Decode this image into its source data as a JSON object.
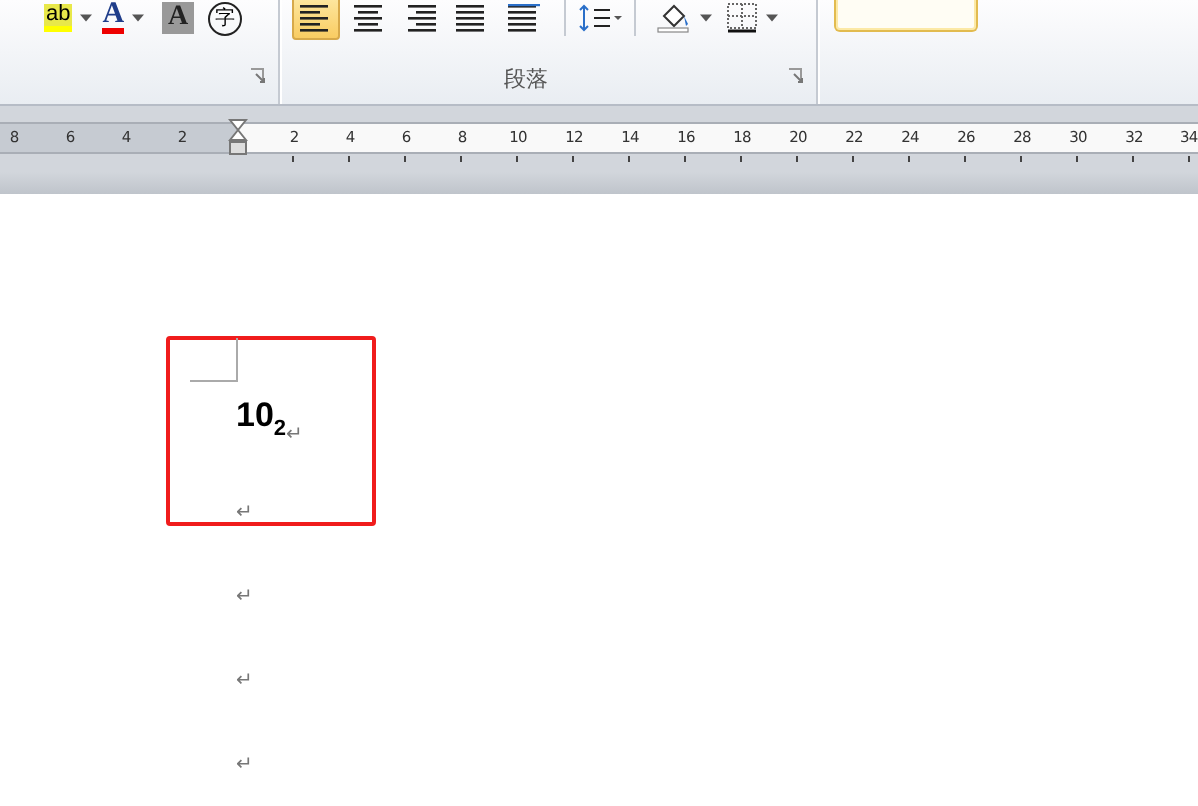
{
  "ribbon": {
    "font_buttons": [
      {
        "kind": "highlight",
        "glyph": "ab"
      },
      {
        "kind": "font_color",
        "glyph": "A"
      },
      {
        "kind": "shading",
        "glyph": "A"
      },
      {
        "kind": "enclosed",
        "glyph": "字"
      }
    ],
    "alignment": [
      {
        "kind": "left",
        "selected": true
      },
      {
        "kind": "center",
        "selected": false
      },
      {
        "kind": "right",
        "selected": false
      },
      {
        "kind": "justify",
        "selected": false
      },
      {
        "kind": "distributed",
        "selected": false
      }
    ],
    "paragraph_label": "段落"
  },
  "ruler": {
    "left_labels": [
      "8",
      "6",
      "4",
      "2"
    ],
    "labels": [
      "2",
      "4",
      "6",
      "8",
      "10",
      "12",
      "14",
      "16",
      "18",
      "20",
      "22",
      "24",
      "26",
      "28",
      "30",
      "32",
      "34"
    ]
  },
  "document": {
    "paragraphs": [
      {
        "text": "10$_{2}$",
        "mark": "↵"
      },
      {
        "mark": "↵"
      },
      {
        "mark": "↵"
      },
      {
        "mark": "↵"
      },
      {
        "mark": "↵"
      }
    ]
  }
}
